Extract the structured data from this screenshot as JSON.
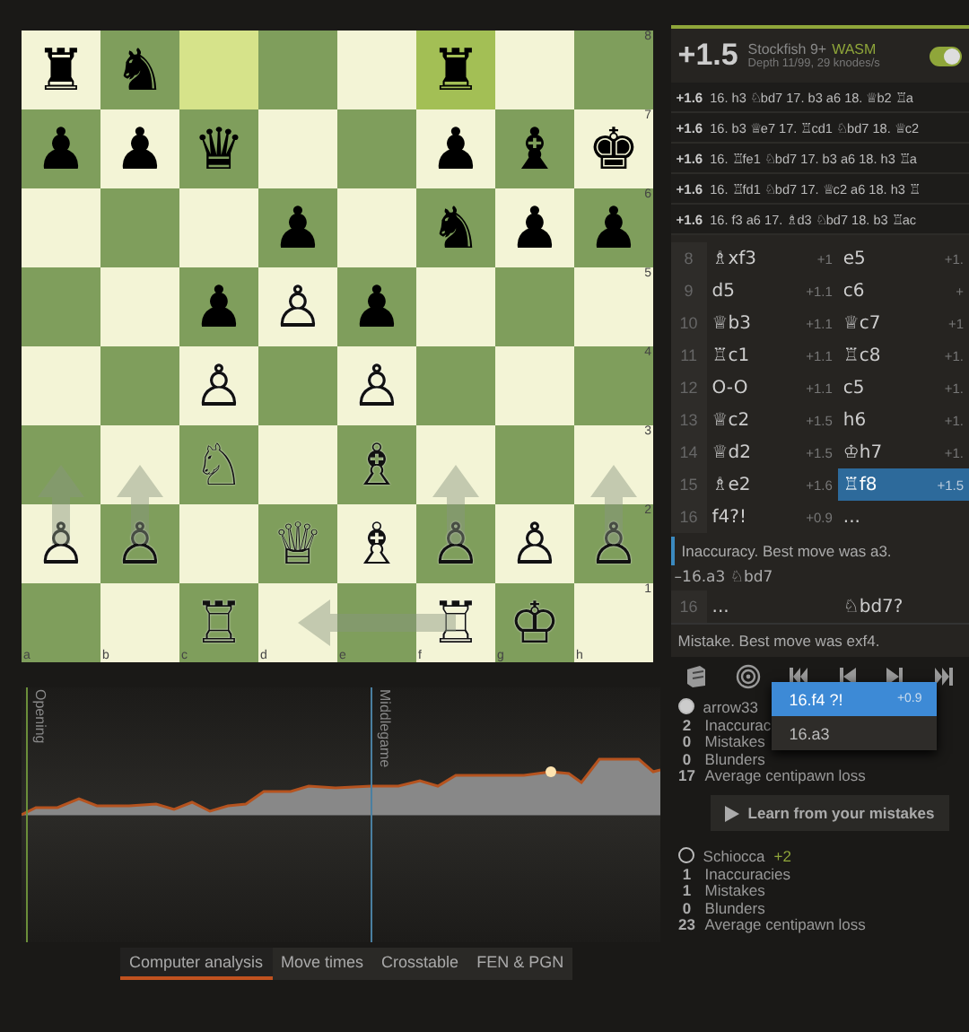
{
  "board": {
    "ranks": [
      "8",
      "7",
      "6",
      "5",
      "4",
      "3",
      "2",
      "1"
    ],
    "files": [
      "a",
      "b",
      "c",
      "d",
      "e",
      "f",
      "g",
      "h"
    ],
    "squares": [
      [
        {
          "glyph": "♜",
          "white": false,
          "highlight": false
        },
        {
          "glyph": "♞",
          "white": false,
          "highlight": false
        },
        {
          "highlight": true
        },
        {
          "highlight": false
        },
        {
          "highlight": false
        },
        {
          "glyph": "♜",
          "white": false,
          "highlight": true
        },
        {
          "highlight": false
        },
        {
          "highlight": false
        }
      ],
      [
        {
          "glyph": "♟",
          "white": false,
          "highlight": false
        },
        {
          "glyph": "♟",
          "white": false,
          "highlight": false
        },
        {
          "glyph": "♛",
          "white": false,
          "highlight": false
        },
        {
          "highlight": false
        },
        {
          "highlight": false
        },
        {
          "glyph": "♟",
          "white": false,
          "highlight": false
        },
        {
          "glyph": "♝",
          "white": false,
          "highlight": false
        },
        {
          "glyph": "♚",
          "white": false,
          "highlight": false
        }
      ],
      [
        {
          "highlight": false
        },
        {
          "highlight": false
        },
        {
          "highlight": false
        },
        {
          "glyph": "♟",
          "white": false,
          "highlight": false
        },
        {
          "highlight": false
        },
        {
          "glyph": "♞",
          "white": false,
          "highlight": false
        },
        {
          "glyph": "♟",
          "white": false,
          "highlight": false
        },
        {
          "glyph": "♟",
          "white": false,
          "highlight": false
        }
      ],
      [
        {
          "highlight": false
        },
        {
          "highlight": false
        },
        {
          "glyph": "♟",
          "white": false,
          "highlight": false
        },
        {
          "glyph": "♙",
          "white": true,
          "highlight": false
        },
        {
          "glyph": "♟",
          "white": false,
          "highlight": false
        },
        {
          "highlight": false
        },
        {
          "highlight": false
        },
        {
          "highlight": false
        }
      ],
      [
        {
          "highlight": false
        },
        {
          "highlight": false
        },
        {
          "glyph": "♙",
          "white": true,
          "highlight": false
        },
        {
          "highlight": false
        },
        {
          "glyph": "♙",
          "white": true,
          "highlight": false
        },
        {
          "highlight": false
        },
        {
          "highlight": false
        },
        {
          "highlight": false
        }
      ],
      [
        {
          "highlight": false
        },
        {
          "highlight": false
        },
        {
          "glyph": "♘",
          "white": true,
          "highlight": false
        },
        {
          "highlight": false
        },
        {
          "glyph": "♗",
          "white": true,
          "highlight": false
        },
        {
          "highlight": false
        },
        {
          "highlight": false
        },
        {
          "highlight": false
        }
      ],
      [
        {
          "glyph": "♙",
          "white": true,
          "highlight": false,
          "kind": "arrow-up"
        },
        {
          "glyph": "♙",
          "white": true,
          "highlight": false,
          "kind": "arrow-up"
        },
        {
          "highlight": false
        },
        {
          "glyph": "♕",
          "white": true,
          "highlight": false
        },
        {
          "glyph": "♗",
          "white": true,
          "highlight": false
        },
        {
          "glyph": "♙",
          "white": true,
          "highlight": false,
          "kind": "arrow-up"
        },
        {
          "glyph": "♙",
          "white": true,
          "highlight": false
        },
        {
          "glyph": "♙",
          "white": true,
          "highlight": false,
          "kind": "arrow-up"
        }
      ],
      [
        {
          "highlight": false
        },
        {
          "highlight": false
        },
        {
          "glyph": "♖",
          "white": true,
          "highlight": false
        },
        {
          "highlight": false
        },
        {
          "highlight": false
        },
        {
          "glyph": "♖",
          "white": true,
          "highlight": false,
          "kind": "arrow-left"
        },
        {
          "glyph": "♔",
          "white": true,
          "highlight": false
        },
        {
          "highlight": false
        }
      ]
    ]
  },
  "chart": {
    "phases": [
      {
        "label": "Opening",
        "kind": "opening"
      },
      {
        "label": "Middlegame",
        "kind": "middlegame"
      }
    ]
  },
  "tabs": [
    {
      "label": "Computer analysis",
      "selected": true
    },
    {
      "label": "Move times",
      "selected": false
    },
    {
      "label": "Crosstable",
      "selected": false
    },
    {
      "label": "FEN & PGN",
      "selected": false
    }
  ],
  "engine": {
    "eval": "+1.5",
    "name": "Stockfish 9+",
    "badge": "WASM",
    "depth": "Depth 11/99, 29 knodes/s",
    "on": true
  },
  "pv_lines": [
    {
      "eval": "+1.6",
      "moves": "16. h3 ♘bd7 17. b3 a6 18. ♕b2 ♖a"
    },
    {
      "eval": "+1.6",
      "moves": "16. b3 ♕e7 17. ♖cd1 ♘bd7 18. ♕c2"
    },
    {
      "eval": "+1.6",
      "moves": "16. ♖fe1 ♘bd7 17. b3 a6 18. h3 ♖a"
    },
    {
      "eval": "+1.6",
      "moves": "16. ♖fd1 ♘bd7 17. ♕c2 a6 18. h3 ♖"
    },
    {
      "eval": "+1.6",
      "moves": "16. f3 a6 17. ♗d3 ♘bd7 18. b3 ♖ac"
    }
  ],
  "moves": [
    {
      "number": "8",
      "white": {
        "san": "♗xf3",
        "eval": "+1",
        "selected": false
      },
      "black": {
        "san": "e5",
        "eval": "+1.",
        "selected": false
      }
    },
    {
      "number": "9",
      "white": {
        "san": "d5",
        "eval": "+1.1",
        "selected": false
      },
      "black": {
        "san": "c6",
        "eval": "+",
        "selected": false
      }
    },
    {
      "number": "10",
      "white": {
        "san": "♕b3",
        "eval": "+1.1",
        "selected": false
      },
      "black": {
        "san": "♕c7",
        "eval": "+1",
        "selected": false
      }
    },
    {
      "number": "11",
      "white": {
        "san": "♖c1",
        "eval": "+1.1",
        "selected": false
      },
      "black": {
        "san": "♖c8",
        "eval": "+1.",
        "selected": false
      }
    },
    {
      "number": "12",
      "white": {
        "san": "O-O",
        "eval": "+1.1",
        "selected": false
      },
      "black": {
        "san": "c5",
        "eval": "+1.",
        "selected": false
      }
    },
    {
      "number": "13",
      "white": {
        "san": "♕c2",
        "eval": "+1.5",
        "selected": false
      },
      "black": {
        "san": "h6",
        "eval": "+1.",
        "selected": false
      }
    },
    {
      "number": "14",
      "white": {
        "san": "♕d2",
        "eval": "+1.5",
        "selected": false
      },
      "black": {
        "san": "♔h7",
        "eval": "+1.",
        "selected": false
      }
    },
    {
      "number": "15",
      "white": {
        "san": "♗e2",
        "eval": "+1.6",
        "selected": false
      },
      "black": {
        "san": "♖f8",
        "eval": "+1.5",
        "selected": true
      }
    },
    {
      "number": "16",
      "white": {
        "san": "f4?!",
        "eval": "+0.9",
        "selected": false
      },
      "black": {
        "san": "...",
        "selected": false
      }
    }
  ],
  "comment_1": "Inaccuracy. Best move was a3.",
  "variation": "–16.a3 ♘bd7",
  "move_row_2": {
    "number": "16",
    "white": "...",
    "black": "♘bd7?"
  },
  "comment_2": "Mistake. Best move was exf4.",
  "popup": [
    {
      "move": "16.f4 ?!",
      "eval": "+0.9",
      "selected": true
    },
    {
      "move": "16.a3",
      "selected": false
    }
  ],
  "players": [
    {
      "name": "arrow33",
      "filled": true,
      "stats": [
        {
          "count": "2",
          "label": "Inaccurac"
        },
        {
          "count": "0",
          "label": "Mistakes"
        },
        {
          "count": "0",
          "label": "Blunders"
        },
        {
          "count": "17",
          "label": "Average centipawn loss"
        }
      ]
    },
    {
      "name": "Schiocca",
      "rating_diff": "+2",
      "filled": false,
      "stats": [
        {
          "count": "1",
          "label": "Inaccuracies"
        },
        {
          "count": "1",
          "label": "Mistakes"
        },
        {
          "count": "0",
          "label": "Blunders"
        },
        {
          "count": "23",
          "label": "Average centipawn loss"
        }
      ]
    }
  ],
  "learn_button": "Learn from your mistakes"
}
